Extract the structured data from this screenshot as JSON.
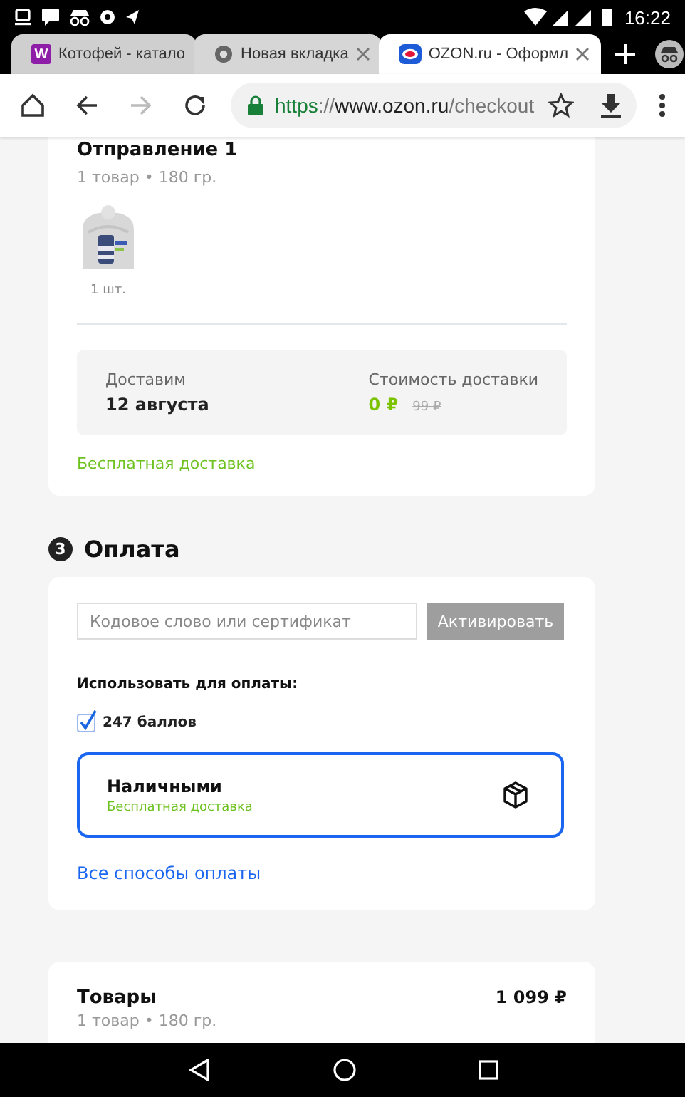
{
  "status_bar": {
    "time": "16:22"
  },
  "tabs": [
    {
      "kind": "letter",
      "letter": "W",
      "title": "Котофей - катало",
      "selected": false,
      "closable": false
    },
    {
      "kind": "chrome",
      "title": "Новая вкладка",
      "selected": false,
      "closable": true
    },
    {
      "kind": "ozon",
      "title": "OZON.ru - Оформл",
      "selected": true,
      "closable": true
    }
  ],
  "address_bar": {
    "scheme": "https",
    "separator": "://",
    "host": "www.ozon.ru",
    "path": "/checkout",
    "secure": true,
    "forward_disabled": true
  },
  "shipment": {
    "title": "Отправление 1",
    "subtitle": "1 товар • 180 гр.",
    "items": [
      {
        "kind": "picture",
        "quantity": "1 шт."
      }
    ],
    "delivery_label": "Доставим",
    "delivery_date": "12 августа",
    "cost_label": "Стоимость доставки",
    "cost": "0 ₽",
    "old_cost": "99 ₽",
    "note": "Бесплатная доставка"
  },
  "payment": {
    "step": "3",
    "title": "Оплата",
    "code_placeholder": "Кодовое слово или сертификат",
    "activate_button": "Активировать",
    "activate_disabled": true,
    "use_label": "Использовать для оплаты:",
    "points": {
      "label": "247 баллов",
      "checked": true
    },
    "options": [
      {
        "title": "Наличными",
        "note": "Бесплатная доставка",
        "selected": true
      }
    ],
    "all_methods_link": "Все способы оплаты"
  },
  "summary": {
    "title": "Товары",
    "subtitle": "1 товар • 180 гр.",
    "price": "1 099 ₽"
  }
}
